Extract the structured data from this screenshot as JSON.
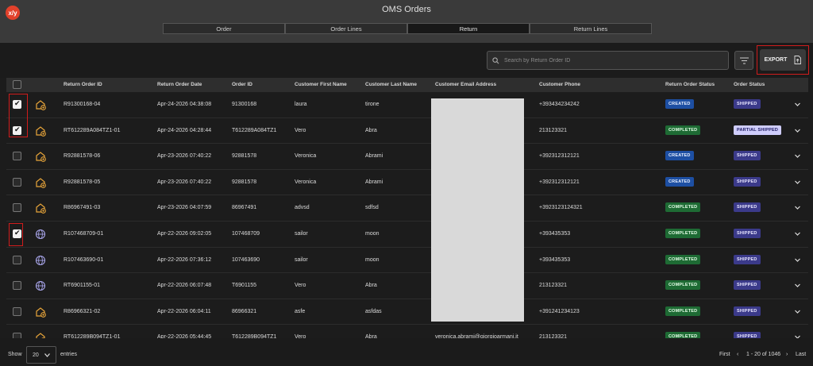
{
  "app": {
    "logo_text": "x/y",
    "title": "OMS Orders",
    "brand_color": "#e2412b"
  },
  "tabs": [
    {
      "label": "Order",
      "active": false
    },
    {
      "label": "Order Lines",
      "active": false
    },
    {
      "label": "Return",
      "active": true
    },
    {
      "label": "Return Lines",
      "active": false
    }
  ],
  "toolbar": {
    "search_placeholder": "Search by Return Order ID",
    "export_label": "EXPORT"
  },
  "columns": [
    "Return Order ID",
    "Return Order Date",
    "Order ID",
    "Customer First Name",
    "Customer Last Name",
    "Customer Email Address",
    "Customer Phone",
    "Return Order Status",
    "Order Status"
  ],
  "rows": [
    {
      "checked": true,
      "icon": "store-return-icon",
      "return_id": "R91300168-04",
      "date": "Apr-24-2026 04:38:08",
      "order_id": "91300168",
      "first": "laura",
      "last": "tirone",
      "email": "",
      "phone": "+393434234242",
      "ret_status": "CREATED",
      "ord_status": "SHIPPED"
    },
    {
      "checked": true,
      "icon": "store-return-icon",
      "return_id": "RT612289A084TZ1-01",
      "date": "Apr-24-2026 04:28:44",
      "order_id": "T612289A084TZ1",
      "first": "Vero",
      "last": "Abra",
      "email": "",
      "phone": "213123321",
      "ret_status": "COMPLETED",
      "ord_status": "PARTIAL SHIPPED"
    },
    {
      "checked": false,
      "icon": "store-return-icon",
      "return_id": "R92881578-06",
      "date": "Apr-23-2026 07:40:22",
      "order_id": "92881578",
      "first": "Veronica",
      "last": "Abrami",
      "email": "",
      "phone": "+392312312121",
      "ret_status": "CREATED",
      "ord_status": "SHIPPED"
    },
    {
      "checked": false,
      "icon": "store-return-icon",
      "return_id": "R92881578-05",
      "date": "Apr-23-2026 07:40:22",
      "order_id": "92881578",
      "first": "Veronica",
      "last": "Abrami",
      "email": "",
      "phone": "+392312312121",
      "ret_status": "CREATED",
      "ord_status": "SHIPPED"
    },
    {
      "checked": false,
      "icon": "store-return-icon",
      "return_id": "R86967491-03",
      "date": "Apr-23-2026 04:07:59",
      "order_id": "86967491",
      "first": "advsd",
      "last": "sdfsd",
      "email": "",
      "phone": "+3923123124321",
      "ret_status": "COMPLETED",
      "ord_status": "SHIPPED"
    },
    {
      "checked": true,
      "icon": "globe-icon",
      "return_id": "R107468709-01",
      "date": "Apr-22-2026 09:02:05",
      "order_id": "107468709",
      "first": "sailor",
      "last": "moon",
      "email": "",
      "phone": "+393435353",
      "ret_status": "COMPLETED",
      "ord_status": "SHIPPED"
    },
    {
      "checked": false,
      "icon": "globe-icon",
      "return_id": "R107463690-01",
      "date": "Apr-22-2026 07:36:12",
      "order_id": "107463690",
      "first": "sailor",
      "last": "moon",
      "email": "",
      "phone": "+393435353",
      "ret_status": "COMPLETED",
      "ord_status": "SHIPPED"
    },
    {
      "checked": false,
      "icon": "globe-icon",
      "return_id": "RT6901155-01",
      "date": "Apr-22-2026 06:07:48",
      "order_id": "T6901155",
      "first": "Vero",
      "last": "Abra",
      "email": "",
      "phone": "213123321",
      "ret_status": "COMPLETED",
      "ord_status": "SHIPPED"
    },
    {
      "checked": false,
      "icon": "store-return-icon",
      "return_id": "R86966321-02",
      "date": "Apr-22-2026 06:04:11",
      "order_id": "86966321",
      "first": "asfe",
      "last": "asfdas",
      "email": "",
      "phone": "+391241234123",
      "ret_status": "COMPLETED",
      "ord_status": "SHIPPED"
    },
    {
      "checked": false,
      "icon": "store-return-icon",
      "return_id": "RT612289B094TZ1-01",
      "date": "Apr-22-2026 05:44:45",
      "order_id": "T612289B094TZ1",
      "first": "Vero",
      "last": "Abra",
      "email": "veronica.abrami@giorgioarmani.it",
      "phone": "213123321",
      "ret_status": "COMPLETED",
      "ord_status": "SHIPPED"
    }
  ],
  "footer": {
    "show_label": "Show",
    "page_size": "20",
    "entries_label": "entries",
    "first_label": "First",
    "range_label": "1 - 20 of 1046",
    "last_label": "Last"
  },
  "colors": {
    "created": "#1d4fa3",
    "completed": "#1e6b34",
    "shipped": "#3b3a8a",
    "partial_shipped": "#cfcdfc",
    "highlight_box": "#d01c1c",
    "store_icon": "#e8a53a",
    "globe_icon": "#a7a4e8"
  }
}
